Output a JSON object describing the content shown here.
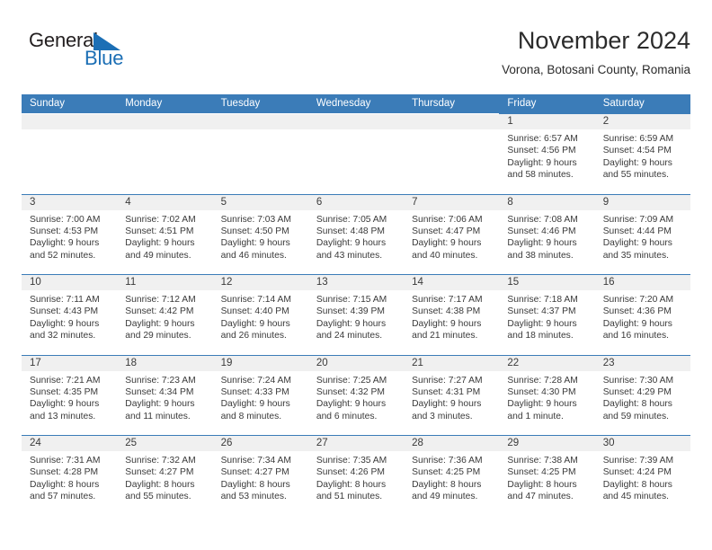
{
  "brand": {
    "name_part1": "General",
    "name_part2": "Blue",
    "triangle_color": "#1c6fb5",
    "text_color": "#231f20"
  },
  "header": {
    "title": "November 2024",
    "location": "Vorona, Botosani County, Romania"
  },
  "theme": {
    "header_bar": "#3b7cb8",
    "day_head_bg": "#f0f0f0",
    "text": "#3a3a3a",
    "accent": "#1c6fb5"
  },
  "calendar": {
    "weekdays": [
      "Sunday",
      "Monday",
      "Tuesday",
      "Wednesday",
      "Thursday",
      "Friday",
      "Saturday"
    ],
    "weeks": [
      [
        {
          "blank": true
        },
        {
          "blank": true
        },
        {
          "blank": true
        },
        {
          "blank": true
        },
        {
          "blank": true
        },
        {
          "date": "1",
          "sunrise": "Sunrise: 6:57 AM",
          "sunset": "Sunset: 4:56 PM",
          "daylight1": "Daylight: 9 hours",
          "daylight2": "and 58 minutes."
        },
        {
          "date": "2",
          "sunrise": "Sunrise: 6:59 AM",
          "sunset": "Sunset: 4:54 PM",
          "daylight1": "Daylight: 9 hours",
          "daylight2": "and 55 minutes."
        }
      ],
      [
        {
          "date": "3",
          "sunrise": "Sunrise: 7:00 AM",
          "sunset": "Sunset: 4:53 PM",
          "daylight1": "Daylight: 9 hours",
          "daylight2": "and 52 minutes."
        },
        {
          "date": "4",
          "sunrise": "Sunrise: 7:02 AM",
          "sunset": "Sunset: 4:51 PM",
          "daylight1": "Daylight: 9 hours",
          "daylight2": "and 49 minutes."
        },
        {
          "date": "5",
          "sunrise": "Sunrise: 7:03 AM",
          "sunset": "Sunset: 4:50 PM",
          "daylight1": "Daylight: 9 hours",
          "daylight2": "and 46 minutes."
        },
        {
          "date": "6",
          "sunrise": "Sunrise: 7:05 AM",
          "sunset": "Sunset: 4:48 PM",
          "daylight1": "Daylight: 9 hours",
          "daylight2": "and 43 minutes."
        },
        {
          "date": "7",
          "sunrise": "Sunrise: 7:06 AM",
          "sunset": "Sunset: 4:47 PM",
          "daylight1": "Daylight: 9 hours",
          "daylight2": "and 40 minutes."
        },
        {
          "date": "8",
          "sunrise": "Sunrise: 7:08 AM",
          "sunset": "Sunset: 4:46 PM",
          "daylight1": "Daylight: 9 hours",
          "daylight2": "and 38 minutes."
        },
        {
          "date": "9",
          "sunrise": "Sunrise: 7:09 AM",
          "sunset": "Sunset: 4:44 PM",
          "daylight1": "Daylight: 9 hours",
          "daylight2": "and 35 minutes."
        }
      ],
      [
        {
          "date": "10",
          "sunrise": "Sunrise: 7:11 AM",
          "sunset": "Sunset: 4:43 PM",
          "daylight1": "Daylight: 9 hours",
          "daylight2": "and 32 minutes."
        },
        {
          "date": "11",
          "sunrise": "Sunrise: 7:12 AM",
          "sunset": "Sunset: 4:42 PM",
          "daylight1": "Daylight: 9 hours",
          "daylight2": "and 29 minutes."
        },
        {
          "date": "12",
          "sunrise": "Sunrise: 7:14 AM",
          "sunset": "Sunset: 4:40 PM",
          "daylight1": "Daylight: 9 hours",
          "daylight2": "and 26 minutes."
        },
        {
          "date": "13",
          "sunrise": "Sunrise: 7:15 AM",
          "sunset": "Sunset: 4:39 PM",
          "daylight1": "Daylight: 9 hours",
          "daylight2": "and 24 minutes."
        },
        {
          "date": "14",
          "sunrise": "Sunrise: 7:17 AM",
          "sunset": "Sunset: 4:38 PM",
          "daylight1": "Daylight: 9 hours",
          "daylight2": "and 21 minutes."
        },
        {
          "date": "15",
          "sunrise": "Sunrise: 7:18 AM",
          "sunset": "Sunset: 4:37 PM",
          "daylight1": "Daylight: 9 hours",
          "daylight2": "and 18 minutes."
        },
        {
          "date": "16",
          "sunrise": "Sunrise: 7:20 AM",
          "sunset": "Sunset: 4:36 PM",
          "daylight1": "Daylight: 9 hours",
          "daylight2": "and 16 minutes."
        }
      ],
      [
        {
          "date": "17",
          "sunrise": "Sunrise: 7:21 AM",
          "sunset": "Sunset: 4:35 PM",
          "daylight1": "Daylight: 9 hours",
          "daylight2": "and 13 minutes."
        },
        {
          "date": "18",
          "sunrise": "Sunrise: 7:23 AM",
          "sunset": "Sunset: 4:34 PM",
          "daylight1": "Daylight: 9 hours",
          "daylight2": "and 11 minutes."
        },
        {
          "date": "19",
          "sunrise": "Sunrise: 7:24 AM",
          "sunset": "Sunset: 4:33 PM",
          "daylight1": "Daylight: 9 hours",
          "daylight2": "and 8 minutes."
        },
        {
          "date": "20",
          "sunrise": "Sunrise: 7:25 AM",
          "sunset": "Sunset: 4:32 PM",
          "daylight1": "Daylight: 9 hours",
          "daylight2": "and 6 minutes."
        },
        {
          "date": "21",
          "sunrise": "Sunrise: 7:27 AM",
          "sunset": "Sunset: 4:31 PM",
          "daylight1": "Daylight: 9 hours",
          "daylight2": "and 3 minutes."
        },
        {
          "date": "22",
          "sunrise": "Sunrise: 7:28 AM",
          "sunset": "Sunset: 4:30 PM",
          "daylight1": "Daylight: 9 hours",
          "daylight2": "and 1 minute."
        },
        {
          "date": "23",
          "sunrise": "Sunrise: 7:30 AM",
          "sunset": "Sunset: 4:29 PM",
          "daylight1": "Daylight: 8 hours",
          "daylight2": "and 59 minutes."
        }
      ],
      [
        {
          "date": "24",
          "sunrise": "Sunrise: 7:31 AM",
          "sunset": "Sunset: 4:28 PM",
          "daylight1": "Daylight: 8 hours",
          "daylight2": "and 57 minutes."
        },
        {
          "date": "25",
          "sunrise": "Sunrise: 7:32 AM",
          "sunset": "Sunset: 4:27 PM",
          "daylight1": "Daylight: 8 hours",
          "daylight2": "and 55 minutes."
        },
        {
          "date": "26",
          "sunrise": "Sunrise: 7:34 AM",
          "sunset": "Sunset: 4:27 PM",
          "daylight1": "Daylight: 8 hours",
          "daylight2": "and 53 minutes."
        },
        {
          "date": "27",
          "sunrise": "Sunrise: 7:35 AM",
          "sunset": "Sunset: 4:26 PM",
          "daylight1": "Daylight: 8 hours",
          "daylight2": "and 51 minutes."
        },
        {
          "date": "28",
          "sunrise": "Sunrise: 7:36 AM",
          "sunset": "Sunset: 4:25 PM",
          "daylight1": "Daylight: 8 hours",
          "daylight2": "and 49 minutes."
        },
        {
          "date": "29",
          "sunrise": "Sunrise: 7:38 AM",
          "sunset": "Sunset: 4:25 PM",
          "daylight1": "Daylight: 8 hours",
          "daylight2": "and 47 minutes."
        },
        {
          "date": "30",
          "sunrise": "Sunrise: 7:39 AM",
          "sunset": "Sunset: 4:24 PM",
          "daylight1": "Daylight: 8 hours",
          "daylight2": "and 45 minutes."
        }
      ]
    ]
  }
}
